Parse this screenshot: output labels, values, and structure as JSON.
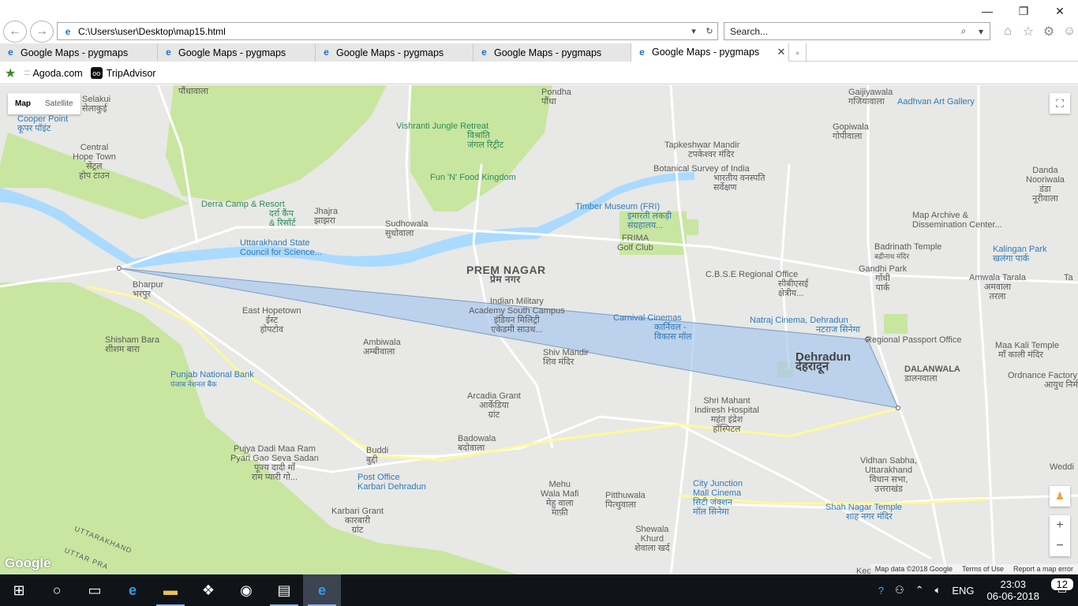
{
  "window": {
    "minimize_icon": "minimize-icon",
    "maximize_icon": "restore-icon",
    "close_icon": "close-icon"
  },
  "navbar": {
    "back_icon": "back-arrow-icon",
    "forward_icon": "forward-arrow-icon",
    "url": "C:\\Users\\user\\Desktop\\map15.html",
    "search_placeholder": "Search...",
    "toolbar_icons": [
      "home-icon",
      "favorites-star-icon",
      "settings-gear-icon",
      "smiley-feedback-icon"
    ]
  },
  "tabs": [
    {
      "title": "Google Maps - pygmaps",
      "active": false
    },
    {
      "title": "Google Maps - pygmaps",
      "active": false
    },
    {
      "title": "Google Maps - pygmaps",
      "active": false
    },
    {
      "title": "Google Maps - pygmaps",
      "active": false
    },
    {
      "title": "Google Maps - pygmaps",
      "active": true
    }
  ],
  "favorites": [
    {
      "label": "Agoda.com"
    },
    {
      "label": "TripAdvisor"
    }
  ],
  "map": {
    "type_buttons": [
      "Map",
      "Satellite"
    ],
    "labels": {
      "selakui": "Selakui",
      "selakui_hi": "सेलाकुई",
      "cooper_point": "Cooper Point",
      "cooper_point_hi": "कूपर पॉइंट",
      "central_hope_town": "Central",
      "central_hope_town2": "Hope Town",
      "central_hope_town_hi": "सेंट्रल",
      "central_hope_town_hi2": "होप टाउन",
      "pondha": "Pondha",
      "pondha_hi": "पौंधा",
      "podhawala": "पौंधावाला",
      "vishranti": "Vishranti Jungle Retreat",
      "vishranti_hi": "विश्रांति",
      "vishranti_hi2": "जंगल रिट्रीट",
      "fun_n_food": "Fun 'N' Food Kingdom",
      "derra_camp": "Derra Camp & Resort",
      "derra_camp_hi": "दर्रा कैंप",
      "derra_camp_hi2": "& रिसॉर्ट",
      "jhajra": "Jhajra",
      "jhajra_hi": "झाझरा",
      "sudhowala": "Sudhowala",
      "sudhowala_hi": "सुधोवाला",
      "ucost": "Uttarakhand State",
      "ucost2": "Council for Science...",
      "prem_nagar": "PREM NAGAR",
      "prem_nagar_hi": "प्रेम नगर",
      "ima": "Indian Military",
      "ima2": "Academy South Campus",
      "ima_hi": "इंडियन मिलिट्री",
      "ima_hi2": "एकेडमी साउथ...",
      "bharpur": "Bharpur",
      "bharpur_hi": "भरपुर",
      "east_hopetown": "East Hopetown",
      "east_hopetown_hi": "ईस्ट",
      "east_hopetown_hi2": "होपटोव",
      "ambiwala": "Ambiwala",
      "ambiwala_hi": "अम्बीवाला",
      "shishambara": "Shisham Bara",
      "shishambara_hi": "शीशम बारा",
      "pnb": "Punjab National Bank",
      "pnb_hi": "पंजाब नेशनल बैंक",
      "arcadia_grant": "Arcadia Grant",
      "arcadia_grant_hi": "आर्केडिया",
      "arcadia_grant_hi2": "ग्रांट",
      "badowala": "Badowala",
      "badowala_hi": "बदोवाला",
      "buddi": "Buddi",
      "buddi_hi": "बुद्दी",
      "pujya": "Pujya Dadi Maa Ram",
      "pujya2": "Pyari Gao Seva Sadan",
      "pujya_hi": "पूज्य दादी माँ",
      "pujya_hi2": "राम प्यारी गो...",
      "post_office": "Post Office",
      "post_office2": "Karbari Dehradun",
      "karbari_grant": "Karbari Grant",
      "karbari_grant_hi": "कारबारी",
      "karbari_grant_hi2": "ग्रांट",
      "mehu_wala": "Mehu",
      "mehu_wala2": "Wala Mafi",
      "mehu_wala_hi": "मेहु वाला",
      "mehu_wala_hi2": "माफ़ी",
      "pitthuwala": "Pitthuwala",
      "pitthuwala_hi": "पित्थुवाला",
      "shewala_khurd": "Shewala",
      "shewala_khurd2": "Khurd",
      "shewala_khurd_hi": "शेवाला खर्द",
      "shiv_mandir": "Shiv Mandir",
      "shiv_mandir_hi": "शिव मंदिर",
      "timber": "Timber Museum (FRI)",
      "timber_hi": "इमारती लकड़ी",
      "timber_hi2": "संग्रहालय...",
      "frima": "FRIMA",
      "frima2": "Golf Club",
      "tapkeshwar": "Tapkeshwar Mandir",
      "tapkeshwar_hi": "टपकेश्वर मंदिर",
      "bsi": "Botanical Survey of India",
      "bsi_hi": "भारतीय वनस्पति",
      "bsi_hi2": "सर्वेक्षण",
      "carnival": "Carnival Cinemas",
      "carnival_hi": "कार्निवल -",
      "carnival_hi2": "विकास मॉल",
      "cbse": "C.B.S.E Regional Office",
      "cbse_hi": "सीबीएसई",
      "cbse_hi2": "क्षेत्रीय...",
      "natraj": "Natraj Cinema, Dehradun",
      "natraj_hi": "नटराज सिनेमा",
      "dehradun": "Dehradun",
      "dehradun_hi": "देहरादून",
      "shri_mahant": "Shri Mahant",
      "shri_mahant2": "Indiresh Hospital",
      "shri_mahant_hi": "महंत इंद्रेश",
      "shri_mahant_hi2": "हॉस्पिटल",
      "city_junction": "City Junction",
      "city_junction2": "Mall Cinema",
      "city_junction_hi": "सिटी जंक्शन",
      "city_junction_hi2": "मॉल सिनेमा",
      "gaijiyawala": "Gaijiyawala",
      "gaijiyawala_hi": "गजियावाला",
      "aadhvan": "Aadhvan Art Gallery",
      "gopiwala": "Gopiwala",
      "gopiwala_hi": "गोपीवाला",
      "danda": "Danda",
      "danda2": "Nooriwala",
      "danda_hi": "डंडा",
      "danda_hi2": "नूरीवाला",
      "map_archive": "Map Archive &",
      "map_archive2": "Dissemination Center...",
      "badrinath": "Badrinath Temple",
      "badrinath_hi": "बद्रीनाथ मंदिर",
      "gandhi_park": "Gandhi Park",
      "gandhi_park_hi": "गाँधी",
      "gandhi_park_hi2": "पार्क",
      "kalingan": "Kalingan Park",
      "kalingan_hi": "खलंगा पार्क",
      "amwala": "Amwala Tarala",
      "amwala_hi": "अमवाला",
      "amwala_hi2": "तरला",
      "regional_passport": "Regional Passport Office",
      "dalanwala": "DALANWALA",
      "dalanwala_hi": "डालनवाला",
      "maa_kali": "Maa Kali Temple",
      "maa_kali_hi": "माँ काली मंदिर",
      "ordnance": "Ordnance Factory",
      "ordnance_hi": "आयुध निर्म",
      "vidhan_sabha": "Vidhan Sabha,",
      "vidhan_sabha2": "Uttarakhand",
      "vidhan_sabha_hi": "विधान सभा,",
      "vidhan_sabha_hi2": "उत्तराखंड",
      "shah_nagar": "Shah Nagar Temple",
      "shah_nagar_hi": "शाह नगर मंदिर",
      "kedar": "Kedar...",
      "ta": "Ta",
      "weddi": "Weddi",
      "uttarakhand_border": "UTTARAKHAND",
      "uttar_pra": "UTTAR PRA"
    },
    "google_logo": "Google",
    "footer": [
      "Map data ©2018 Google",
      "Terms of Use",
      "Report a map error"
    ],
    "polygon_vertices": [
      {
        "name": "Bharpur",
        "lat": 30.3422,
        "lng": 77.928
      },
      {
        "name": "Regional Passport Office",
        "lat": 30.3324,
        "lng": 78.0565
      },
      {
        "name": "Dalanwala",
        "lat": 30.3223,
        "lng": 78.06
      }
    ],
    "colors": {
      "polygon_fill": "#a9c8ec",
      "polygon_stroke": "#7a9cc4",
      "water": "#aadaff",
      "park": "#c8e6a0",
      "road": "#ffffff",
      "highway": "#fdfa9b"
    }
  },
  "taskbar": {
    "apps": [
      "windows-start-icon",
      "cortana-icon",
      "task-view-icon",
      "edge-icon",
      "file-explorer-icon",
      "dropbox-icon",
      "groove-icon",
      "python-file-icon",
      "internet-explorer-icon"
    ],
    "tray": [
      "help-icon",
      "people-icon",
      "chevron-up-icon",
      "volume-icon"
    ],
    "language": "ENG",
    "time": "23:03",
    "date": "06-06-2018",
    "notification_count": "12"
  }
}
